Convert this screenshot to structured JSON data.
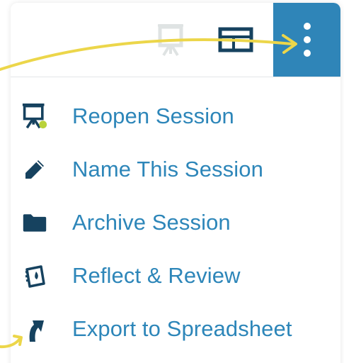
{
  "toolbar": {
    "buttons": [
      {
        "icon": "presentation-easel-icon"
      },
      {
        "icon": "layout-panels-icon"
      },
      {
        "icon": "vertical-dots-icon"
      }
    ]
  },
  "menu": {
    "items": [
      {
        "label": "Reopen Session",
        "icon": "reopen-easel-icon"
      },
      {
        "label": "Name This Session",
        "icon": "pencil-icon"
      },
      {
        "label": "Archive Session",
        "icon": "folder-icon"
      },
      {
        "label": "Reflect & Review",
        "icon": "reflect-review-icon"
      },
      {
        "label": "Export to Spreadsheet",
        "icon": "export-arrow-icon"
      }
    ]
  },
  "colors": {
    "accent": "#2f85b8",
    "label": "#2d86b9",
    "icon_dark": "#16425f",
    "status_dot": "#b9d23a",
    "annotation_arrow": "#ecd64a",
    "icon_muted": "#dfe3e3"
  }
}
